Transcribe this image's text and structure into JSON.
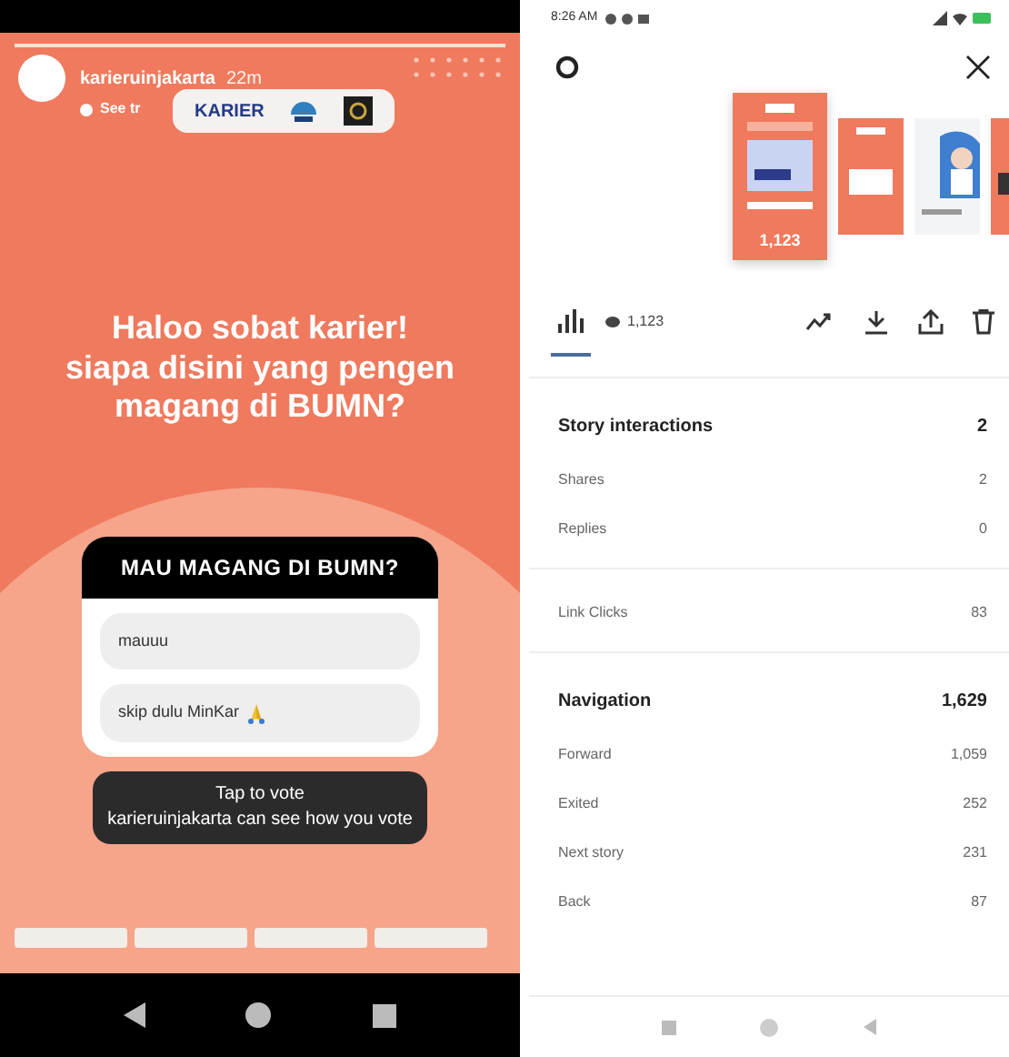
{
  "story": {
    "account": "karieruinjakarta",
    "time": "22m",
    "subtitle": "See tr",
    "sticker_text": "KARIER",
    "headline": [
      "Haloo sobat karier!",
      "siapa disini yang pengen",
      "magang di BUMN?"
    ],
    "poll": {
      "question": "MAU MAGANG DI BUMN?",
      "options": [
        {
          "text": "mauuu",
          "emoji": false
        },
        {
          "text": "skip dulu MinKar",
          "emoji": true
        }
      ]
    },
    "tooltip": {
      "title": "Tap to vote",
      "note": "karieruinjakarta can see how you vote"
    },
    "progress": {
      "level": 1
    }
  },
  "insights": {
    "status_time": "8:26 AM",
    "thumbnail_views": "1,123",
    "views": "1,123",
    "tabs": [
      {
        "kind": "insights",
        "selected": true
      }
    ],
    "sections": [
      {
        "title": "Story interactions",
        "total": "2",
        "rows": [
          {
            "label": "Shares",
            "value": "2"
          },
          {
            "label": "Replies",
            "value": "0"
          }
        ]
      },
      {
        "rows": [
          {
            "label": "Link Clicks",
            "value": "83"
          }
        ]
      },
      {
        "title": "Navigation",
        "total": "1,629",
        "rows": [
          {
            "label": "Forward",
            "value": "1,059"
          },
          {
            "label": "Exited",
            "value": "252"
          },
          {
            "label": "Next story",
            "value": "231"
          },
          {
            "label": "Back",
            "value": "87"
          }
        ]
      }
    ]
  }
}
